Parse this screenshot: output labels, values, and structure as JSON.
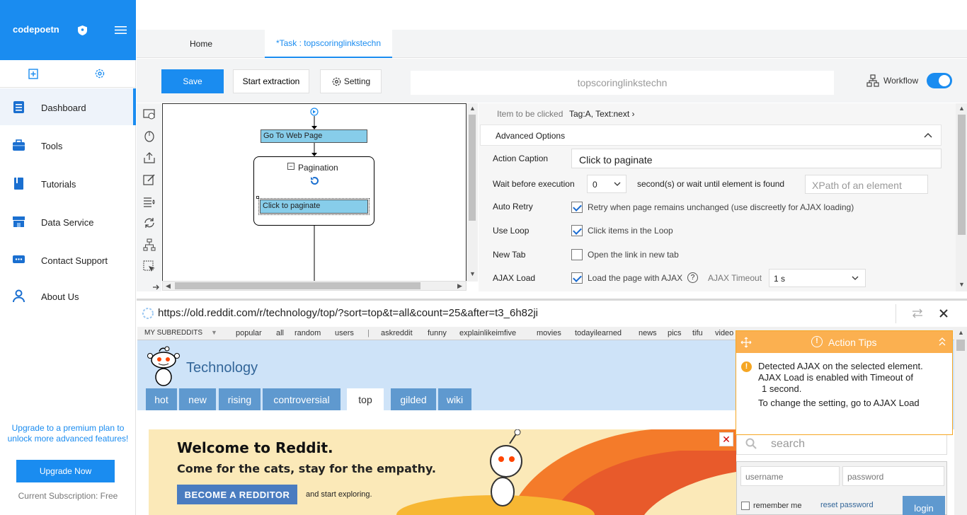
{
  "sidebar": {
    "brand": "codepoetn",
    "nav": [
      {
        "label": "Dashboard",
        "icon": "dashboard-icon"
      },
      {
        "label": "Tools",
        "icon": "briefcase-icon"
      },
      {
        "label": "Tutorials",
        "icon": "book-icon"
      },
      {
        "label": "Data Service",
        "icon": "store-icon"
      },
      {
        "label": "Contact Support",
        "icon": "chat-icon"
      },
      {
        "label": "About Us",
        "icon": "user-icon"
      }
    ],
    "upgrade_text": "Upgrade to a premium plan to unlock more advanced features!",
    "upgrade_button": "Upgrade Now",
    "subscription": "Current Subscription: Free"
  },
  "tabs": {
    "home": "Home",
    "task": "*Task : topscoringlinkstechn"
  },
  "toolbar": {
    "save": "Save",
    "start": "Start extraction",
    "setting": "Setting",
    "task_name": "topscoringlinkstechn",
    "workflow": "Workflow"
  },
  "workflow": {
    "node1": "Go To Web Page",
    "loop": "Pagination",
    "node2": "Click to paginate"
  },
  "options": {
    "item_label": "Item to be clicked",
    "item_value": "Tag:A, Text:next ›",
    "advanced": "Advanced Options",
    "action_caption_label": "Action Caption",
    "action_caption_value": "Click to paginate",
    "wait_label": "Wait before execution",
    "wait_value": "0",
    "wait_suffix": "second(s)  or wait until element is found",
    "xpath_placeholder": "XPath of an element",
    "auto_retry_label": "Auto Retry",
    "auto_retry_text": "Retry when page remains unchanged (use discreetly for AJAX loading)",
    "use_loop_label": "Use Loop",
    "use_loop_text": "Click items in the Loop",
    "new_tab_label": "New Tab",
    "new_tab_text": "Open the link in new tab",
    "ajax_label": "AJAX Load",
    "ajax_text": "Load the page with AJAX",
    "ajax_timeout_label": "AJAX Timeout",
    "ajax_timeout_value": "1 s"
  },
  "browser": {
    "url": "https://old.reddit.com/r/technology/top/?sort=top&t=all&count=25&after=t3_6h82ji",
    "my_subreddits": "MY SUBREDDITS",
    "sr_links": [
      "popular",
      "all",
      "random",
      "users",
      "|",
      "askreddit",
      "funny",
      "explainlikeimfive",
      "movies",
      "todayilearned",
      "news",
      "pics",
      "tifu",
      "video"
    ],
    "subreddit": "Technology",
    "tabs": [
      "hot",
      "new",
      "rising",
      "controversial",
      "top",
      "gilded",
      "wiki"
    ],
    "banner_title": "Welcome to Reddit.",
    "banner_sub": "Come for the cats, stay for the empathy.",
    "banner_button": "BECOME A REDDITOR",
    "banner_explore": "and start exploring.",
    "search_placeholder": "search",
    "username_placeholder": "username",
    "password_placeholder": "password",
    "remember": "remember me",
    "reset": "reset password",
    "login": "login"
  },
  "tips": {
    "title": "Action Tips",
    "line1": "Detected AJAX on the selected element.",
    "line2": "AJAX Load is enabled with Timeout of",
    "line3": "1 second.",
    "line4": "To change the setting, go to AJAX Load"
  },
  "colors": {
    "accent": "#1a8cf0",
    "reddit_blue": "#5f99cf",
    "tips_orange": "#fbb050"
  }
}
